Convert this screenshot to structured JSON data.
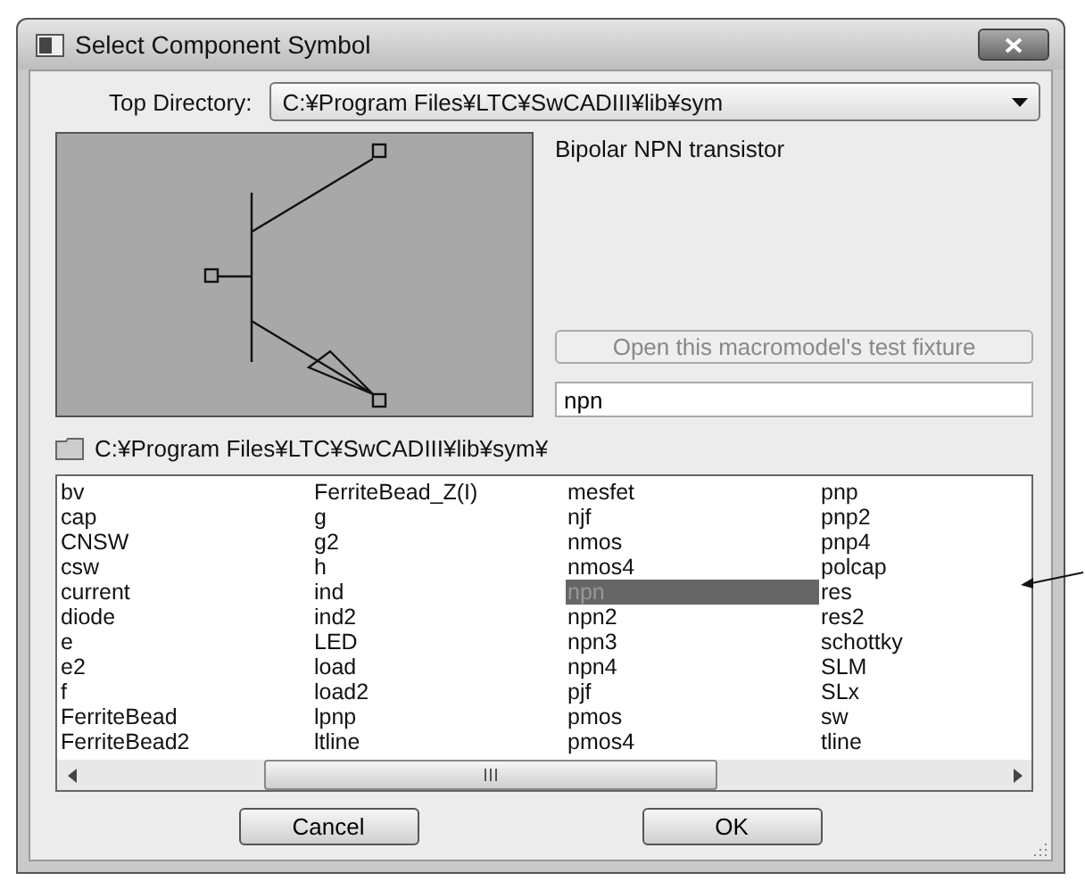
{
  "window": {
    "title": "Select Component Symbol"
  },
  "top_directory": {
    "label": "Top Directory:",
    "value": "C:¥Program Files¥LTC¥SwCADIII¥lib¥sym"
  },
  "description": "Bipolar NPN transistor",
  "test_fixture_button": {
    "label": "Open this macromodel's test fixture",
    "disabled": true
  },
  "symbol_field": {
    "value": "npn"
  },
  "folder_path": "C:¥Program Files¥LTC¥SwCADIII¥lib¥sym¥",
  "symbols": [
    {
      "label": "bv",
      "selected": false
    },
    {
      "label": "cap",
      "selected": false
    },
    {
      "label": "CNSW",
      "selected": false
    },
    {
      "label": "csw",
      "selected": false
    },
    {
      "label": "current",
      "selected": false
    },
    {
      "label": "diode",
      "selected": false
    },
    {
      "label": "e",
      "selected": false
    },
    {
      "label": "e2",
      "selected": false
    },
    {
      "label": "f",
      "selected": false
    },
    {
      "label": "FerriteBead",
      "selected": false
    },
    {
      "label": "FerriteBead2",
      "selected": false
    },
    {
      "label": "FerriteBead_Z(I)",
      "selected": false
    },
    {
      "label": "g",
      "selected": false
    },
    {
      "label": "g2",
      "selected": false
    },
    {
      "label": "h",
      "selected": false
    },
    {
      "label": "ind",
      "selected": false
    },
    {
      "label": "ind2",
      "selected": false
    },
    {
      "label": "LED",
      "selected": false
    },
    {
      "label": "load",
      "selected": false
    },
    {
      "label": "load2",
      "selected": false
    },
    {
      "label": "lpnp",
      "selected": false
    },
    {
      "label": "ltline",
      "selected": false
    },
    {
      "label": "mesfet",
      "selected": false
    },
    {
      "label": "njf",
      "selected": false
    },
    {
      "label": "nmos",
      "selected": false
    },
    {
      "label": "nmos4",
      "selected": false
    },
    {
      "label": "npn",
      "selected": true
    },
    {
      "label": "npn2",
      "selected": false
    },
    {
      "label": "npn3",
      "selected": false
    },
    {
      "label": "npn4",
      "selected": false
    },
    {
      "label": "pjf",
      "selected": false
    },
    {
      "label": "pmos",
      "selected": false
    },
    {
      "label": "pmos4",
      "selected": false
    },
    {
      "label": "pnp",
      "selected": false
    },
    {
      "label": "pnp2",
      "selected": false
    },
    {
      "label": "pnp4",
      "selected": false
    },
    {
      "label": "polcap",
      "selected": false
    },
    {
      "label": "res",
      "selected": false
    },
    {
      "label": "res2",
      "selected": false
    },
    {
      "label": "schottky",
      "selected": false
    },
    {
      "label": "SLM",
      "selected": false
    },
    {
      "label": "SLx",
      "selected": false
    },
    {
      "label": "sw",
      "selected": false
    },
    {
      "label": "tline",
      "selected": false
    }
  ],
  "cancel_button": {
    "label": "Cancel"
  },
  "ok_button": {
    "label": "OK"
  }
}
